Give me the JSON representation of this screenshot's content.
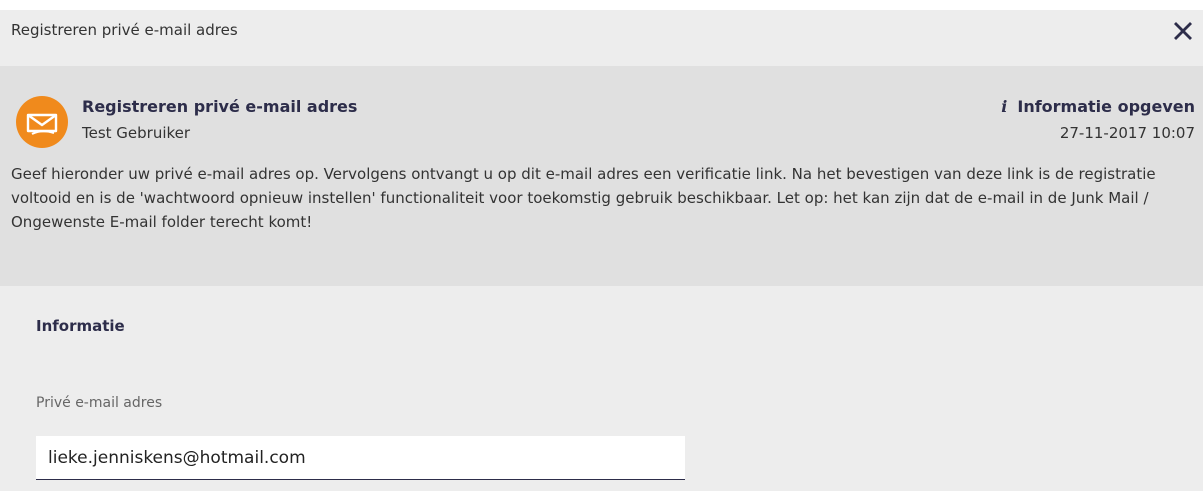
{
  "window": {
    "title": "Registreren privé e-mail adres",
    "close_icon": "close-icon"
  },
  "header": {
    "title": "Registreren privé e-mail adres",
    "user": "Test Gebruiker",
    "action_label": "Informatie opgeven",
    "action_icon": "info-icon",
    "date": "27-11-2017 10:07",
    "avatar_icon": "envelope-icon",
    "accent_color": "#f08a1c"
  },
  "description": "Geef hieronder uw privé e-mail adres op. Vervolgens ontvangt u op dit e-mail adres een verificatie link. Na het bevestigen van deze link is de registratie voltooid en is de 'wachtwoord opnieuw instellen' functionaliteit voor toekomstig gebruik beschikbaar. Let op: het kan zijn dat de e-mail in de Junk Mail / Ongewenste E-mail folder terecht komt!",
  "form": {
    "section_title": "Informatie",
    "email_label": "Privé e-mail adres",
    "email_value": "lieke.jenniskens@hotmail.com"
  }
}
